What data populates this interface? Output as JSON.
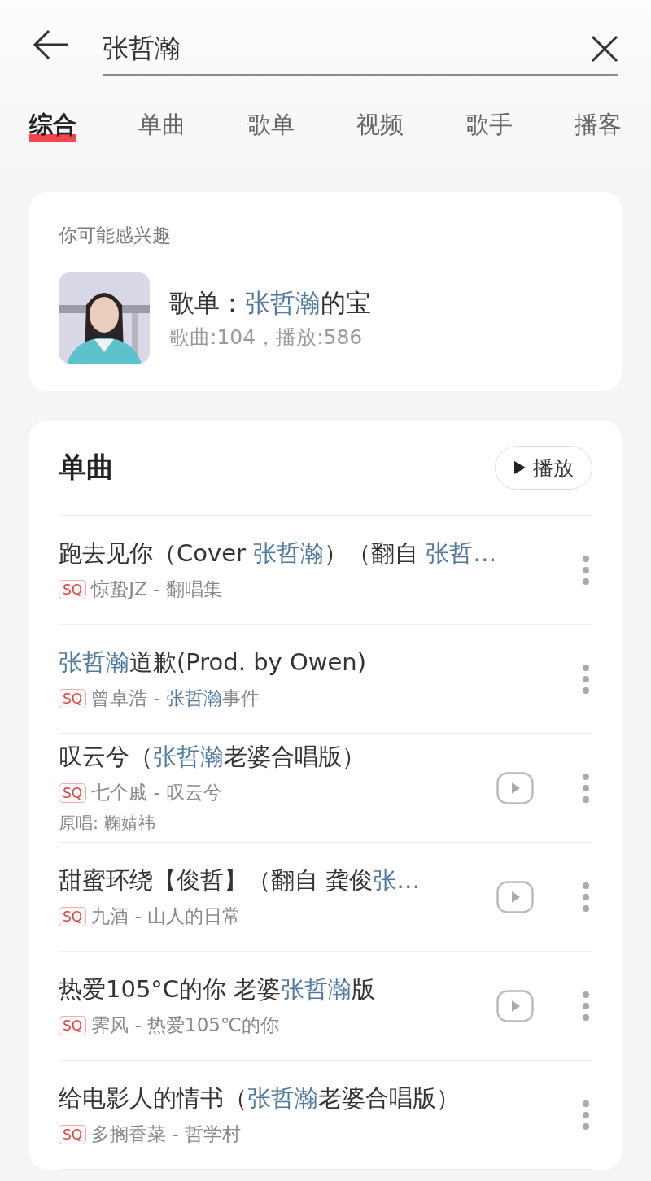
{
  "search": {
    "value": "张哲瀚"
  },
  "tabs": [
    {
      "label": "综合",
      "selected": true
    },
    {
      "label": "单曲",
      "selected": false
    },
    {
      "label": "歌单",
      "selected": false
    },
    {
      "label": "视频",
      "selected": false
    },
    {
      "label": "歌手",
      "selected": false
    },
    {
      "label": "播客",
      "selected": false
    }
  ],
  "suggestion": {
    "heading": "你可能感兴趣",
    "title": [
      {
        "text": "歌单：",
        "highlight": false
      },
      {
        "text": "张哲瀚",
        "highlight": true
      },
      {
        "text": "的宝",
        "highlight": false
      }
    ],
    "stats": "歌曲:104，播放:586"
  },
  "songs": {
    "heading": "单曲",
    "play_button": "播放",
    "items": [
      {
        "title": [
          {
            "text": "跑去见你（Cover ",
            "highlight": false
          },
          {
            "text": "张哲瀚",
            "highlight": true
          },
          {
            "text": "）（翻自 ",
            "highlight": false
          },
          {
            "text": "张哲…",
            "highlight": true
          }
        ],
        "badge": "SQ",
        "subtitle": [
          {
            "text": "惊蛰JZ - 翻唱集",
            "highlight": false
          }
        ],
        "video": false
      },
      {
        "title": [
          {
            "text": "张哲瀚",
            "highlight": true
          },
          {
            "text": "道歉(Prod. by Owen)",
            "highlight": false
          }
        ],
        "badge": "SQ",
        "subtitle": [
          {
            "text": "曾卓浩 - ",
            "highlight": false
          },
          {
            "text": "张哲瀚",
            "highlight": true
          },
          {
            "text": "事件",
            "highlight": false
          }
        ],
        "video": false
      },
      {
        "title": [
          {
            "text": "叹云兮（",
            "highlight": false
          },
          {
            "text": "张哲瀚",
            "highlight": true
          },
          {
            "text": "老婆合唱版）",
            "highlight": false
          }
        ],
        "badge": "SQ",
        "subtitle": [
          {
            "text": "七个戚 - 叹云兮",
            "highlight": false
          }
        ],
        "original": "原唱: 鞠婧祎",
        "video": true
      },
      {
        "title": [
          {
            "text": "甜蜜环绕【俊哲】（翻自 龚俊",
            "highlight": false
          },
          {
            "text": "张…",
            "highlight": true
          }
        ],
        "badge": "SQ",
        "subtitle": [
          {
            "text": "九酒 - 山人的日常",
            "highlight": false
          }
        ],
        "video": true
      },
      {
        "title": [
          {
            "text": "热爱105°C的你 老婆",
            "highlight": false
          },
          {
            "text": "张哲瀚",
            "highlight": true
          },
          {
            "text": "版",
            "highlight": false
          }
        ],
        "badge": "SQ",
        "subtitle": [
          {
            "text": "霁风 - 热爱105℃的你",
            "highlight": false
          }
        ],
        "video": true
      },
      {
        "title": [
          {
            "text": "给电影人的情书（",
            "highlight": false
          },
          {
            "text": "张哲瀚",
            "highlight": true
          },
          {
            "text": "老婆合唱版）",
            "highlight": false
          }
        ],
        "badge": "SQ",
        "subtitle": [
          {
            "text": "多搁香菜 - 哲学村",
            "highlight": false
          }
        ],
        "video": false
      }
    ]
  }
}
